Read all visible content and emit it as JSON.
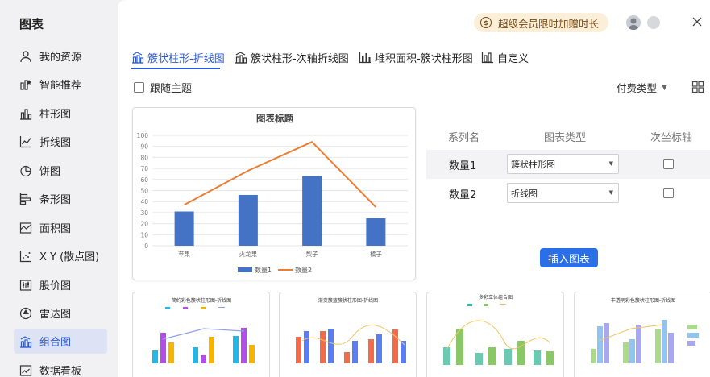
{
  "sidebar": {
    "title": "图表",
    "items": [
      {
        "label": "我的资源",
        "icon": "user-icon"
      },
      {
        "label": "智能推荐",
        "icon": "smart-recommend-icon"
      },
      {
        "label": "柱形图",
        "icon": "bar-chart-icon"
      },
      {
        "label": "折线图",
        "icon": "line-chart-icon"
      },
      {
        "label": "饼图",
        "icon": "pie-chart-icon"
      },
      {
        "label": "条形图",
        "icon": "horizontal-bar-icon"
      },
      {
        "label": "面积图",
        "icon": "area-chart-icon"
      },
      {
        "label": "X Y (散点图)",
        "icon": "scatter-icon"
      },
      {
        "label": "股价图",
        "icon": "stock-chart-icon"
      },
      {
        "label": "雷达图",
        "icon": "radar-chart-icon"
      },
      {
        "label": "组合图",
        "icon": "combo-chart-icon",
        "active": true
      },
      {
        "label": "数据看板",
        "icon": "dashboard-icon"
      }
    ]
  },
  "header": {
    "vip_label": "超级会员限时加赠时长",
    "vip_icon_text": "$"
  },
  "tabs": [
    {
      "label": "簇状柱形-折线图",
      "active": true
    },
    {
      "label": "簇状柱形-次轴折线图"
    },
    {
      "label": "堆积面积-簇状柱形图"
    },
    {
      "label": "自定义"
    }
  ],
  "options": {
    "follow_theme": "跟随主题",
    "paid_type": "付费类型"
  },
  "series_table": {
    "headers": [
      "系列名",
      "图表类型",
      "次坐标轴"
    ],
    "rows": [
      {
        "name": "数量1",
        "type": "簇状柱形图",
        "secondary": false
      },
      {
        "name": "数量2",
        "type": "折线图",
        "secondary": false
      }
    ]
  },
  "insert_button": "插入图表",
  "chart_data": {
    "type": "bar",
    "title": "图表标题",
    "categories": [
      "苹果",
      "火龙果",
      "梨子",
      "橘子"
    ],
    "ylim": [
      0,
      100
    ],
    "yticks": [
      0,
      10,
      20,
      30,
      40,
      50,
      60,
      70,
      80,
      90,
      100
    ],
    "series": [
      {
        "name": "数量1",
        "kind": "bar",
        "color": "#4472c4",
        "values": [
          31,
          46,
          63,
          25
        ]
      },
      {
        "name": "数量2",
        "kind": "line",
        "color": "#ed7d31",
        "values": [
          37,
          68,
          94,
          35
        ]
      }
    ],
    "legend": "bottom",
    "grid": true
  },
  "templates": [
    {
      "title": "简约彩色簇状柱形图-折线图"
    },
    {
      "title": "渐变簇蓝簇状柱形图-折线图"
    },
    {
      "title": "多彩立体组合图"
    },
    {
      "title": "丰透明彩色簇状柱形图-折线图"
    }
  ],
  "colors": {
    "accent": "#2a5bd7",
    "button": "#2a6fe8",
    "vip_bg": "#fcefd9",
    "vip_text": "#7a4b11"
  }
}
